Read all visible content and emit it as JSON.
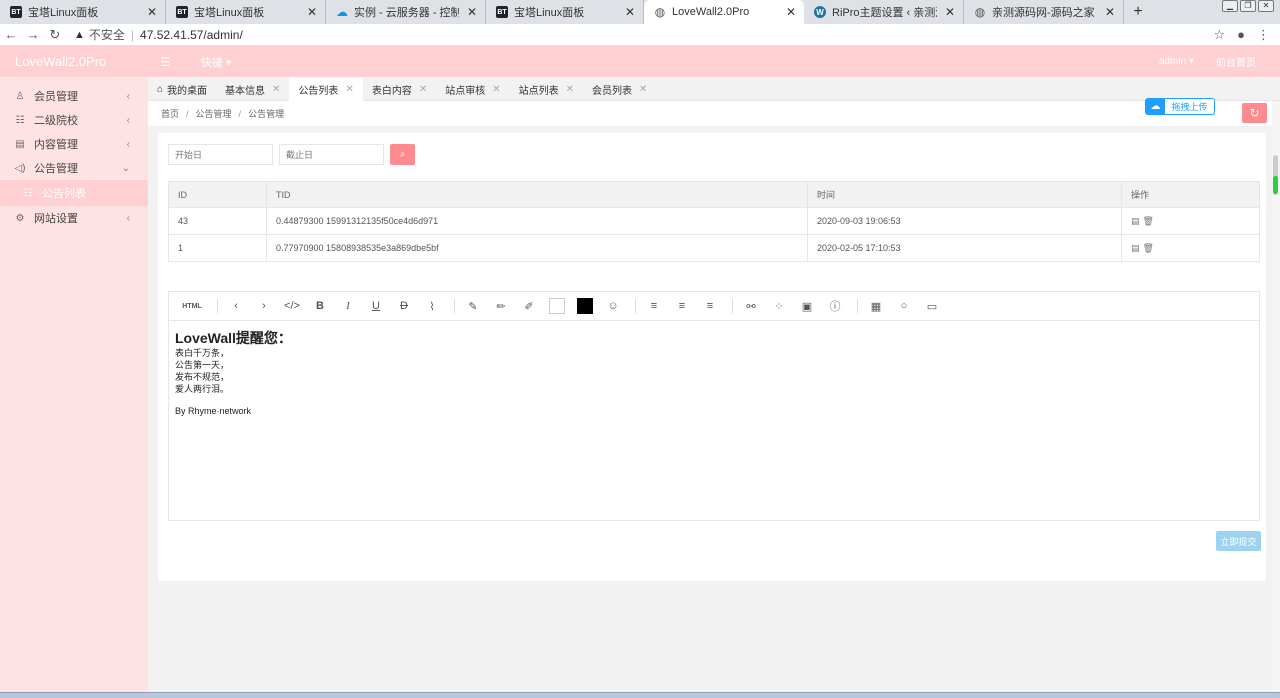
{
  "browser": {
    "tabs": [
      {
        "label": "宝塔Linux面板",
        "favicon": "bt-icon",
        "active": false
      },
      {
        "label": "宝塔Linux面板",
        "favicon": "bt-icon",
        "active": false
      },
      {
        "label": "实例 - 云服务器 - 控制台",
        "favicon": "cloud-icon",
        "active": false
      },
      {
        "label": "宝塔Linux面板",
        "favicon": "bt-icon",
        "active": false
      },
      {
        "label": "LoveWall2.0Pro",
        "favicon": "globe-icon",
        "active": true
      },
      {
        "label": "RiPro主题设置 ‹ 亲测源码网 — W",
        "favicon": "wordpress-icon",
        "active": false
      },
      {
        "label": "亲测源码网-源码之家",
        "favicon": "globe-icon",
        "active": false
      }
    ],
    "security_label": "不安全",
    "url": "47.52.41.57/admin/"
  },
  "header": {
    "logo": "LoveWall2.0Pro",
    "quick": "快捷",
    "user": "admin",
    "frontend_link": "前台首页"
  },
  "sidebar": {
    "items": [
      {
        "label": "会员管理",
        "icon": "user-icon"
      },
      {
        "label": "二级院校",
        "icon": "list-icon"
      },
      {
        "label": "内容管理",
        "icon": "doc-icon"
      },
      {
        "label": "公告管理",
        "icon": "speaker-icon"
      },
      {
        "label": "公告列表",
        "icon": "list-icon"
      },
      {
        "label": "网站设置",
        "icon": "gear-icon"
      }
    ]
  },
  "pagetabs": [
    {
      "label": "我的桌面"
    },
    {
      "label": "基本信息"
    },
    {
      "label": "公告列表"
    },
    {
      "label": "表白内容"
    },
    {
      "label": "站点审核"
    },
    {
      "label": "站点列表"
    },
    {
      "label": "会员列表"
    }
  ],
  "breadcrumb": [
    "首页",
    "公告管理",
    "公告管理"
  ],
  "upload_label": "拖拽上传",
  "filters": {
    "start_placeholder": "开始日",
    "end_placeholder": "截止日"
  },
  "table": {
    "headers": [
      "ID",
      "TID",
      "时间",
      "操作"
    ],
    "rows": [
      {
        "id": "43",
        "tid": "0.44879300 15991312135f50ce4d6d971",
        "time": "2020-09-03 19:06:53"
      },
      {
        "id": "1",
        "tid": "0.77970900 15808938535e3a869dbe5bf",
        "time": "2020-02-05 17:10:53"
      }
    ]
  },
  "editor": {
    "html_label": "HTML",
    "heading": "LoveWall提醒您：",
    "lines": [
      "表白千万条，",
      "公告第一天，",
      "发布不规范，",
      "爱人两行泪。"
    ],
    "signature": "By Rhyme·network"
  },
  "submit_label": "立即提交",
  "colors": {
    "header_bg": "#ffd0d2",
    "sidebar_bg": "#ffe2e4",
    "accent": "#ff8a8f",
    "upload_blue": "#1e9fff",
    "submit_bg": "#9ed3f0"
  }
}
